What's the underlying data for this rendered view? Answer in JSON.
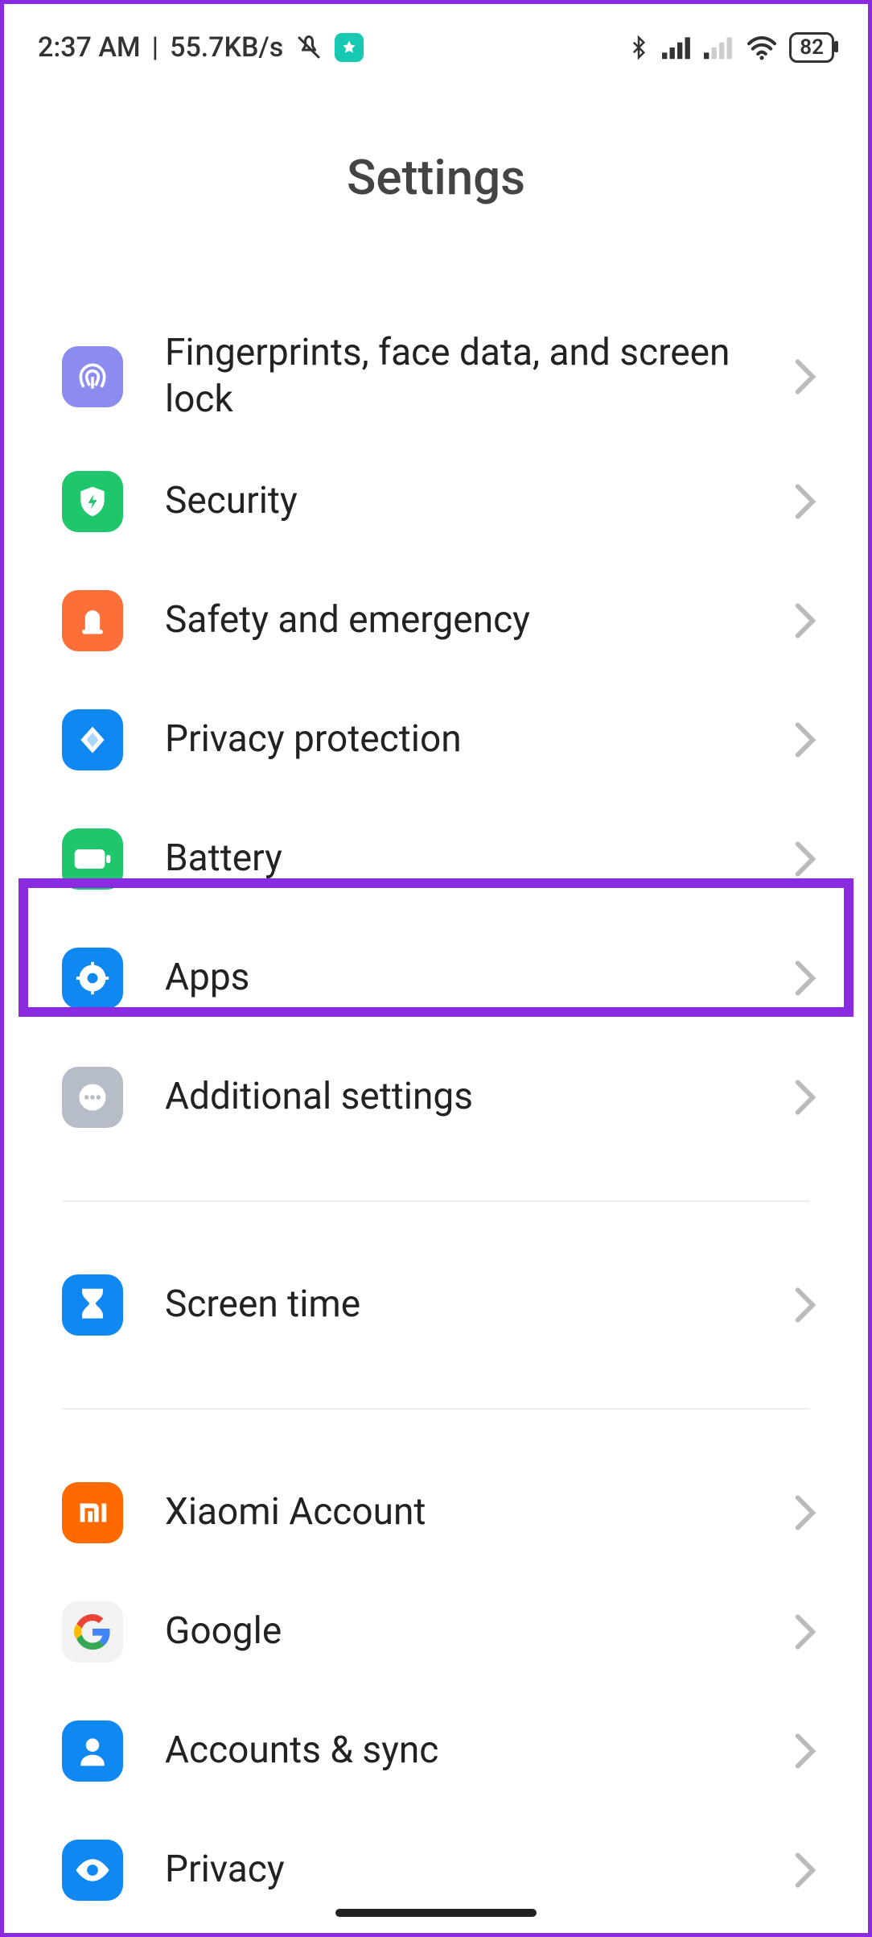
{
  "status": {
    "time": "2:37 AM",
    "net_speed": "55.7KB/s",
    "battery": "82"
  },
  "page": {
    "title": "Settings"
  },
  "groups": [
    {
      "items": [
        {
          "id": "fingerprint",
          "label": "Fingerprints, face data, and screen lock",
          "icon_bg": "#8b8bf0",
          "icon": "fingerprint"
        },
        {
          "id": "security",
          "label": "Security",
          "icon_bg": "#1fc66b",
          "icon": "shield-bolt"
        },
        {
          "id": "safety",
          "label": "Safety and emergency",
          "icon_bg": "#fd6f38",
          "icon": "siren"
        },
        {
          "id": "privacy-protection",
          "label": "Privacy protection",
          "icon_bg": "#1088f2",
          "icon": "diamond"
        },
        {
          "id": "battery",
          "label": "Battery",
          "icon_bg": "#1fc66b",
          "icon": "battery"
        },
        {
          "id": "apps",
          "label": "Apps",
          "icon_bg": "#1088f2",
          "icon": "gear",
          "highlighted": true
        },
        {
          "id": "additional",
          "label": "Additional settings",
          "icon_bg": "#b6bdc6",
          "icon": "dots"
        }
      ]
    },
    {
      "items": [
        {
          "id": "screen-time",
          "label": "Screen time",
          "icon_bg": "#1088f2",
          "icon": "hourglass"
        }
      ]
    },
    {
      "items": [
        {
          "id": "xiaomi-account",
          "label": "Xiaomi Account",
          "icon_bg": "#ff6a00",
          "icon": "mi"
        },
        {
          "id": "google",
          "label": "Google",
          "icon_bg": "#f2f2f2",
          "icon": "google"
        },
        {
          "id": "accounts-sync",
          "label": "Accounts & sync",
          "icon_bg": "#1088f2",
          "icon": "person"
        },
        {
          "id": "privacy",
          "label": "Privacy",
          "icon_bg": "#1088f2",
          "icon": "eye"
        }
      ]
    }
  ]
}
